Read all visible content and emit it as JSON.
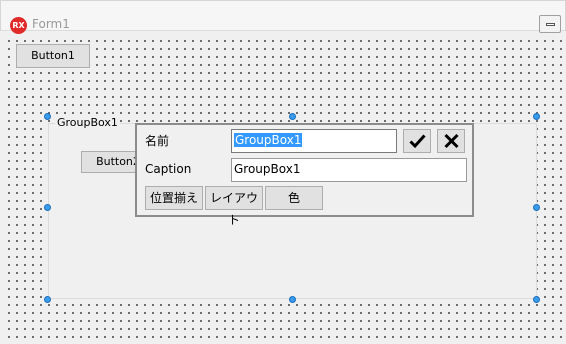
{
  "window": {
    "title": "Form1",
    "app_icon": "RX"
  },
  "form": {
    "button1_label": "Button1",
    "groupbox_label": "GroupBox1",
    "button2_label": "Button2"
  },
  "editor": {
    "name_label": "名前",
    "name_value": "GroupBox1",
    "caption_label": "Caption",
    "caption_value": "GroupBox1",
    "ok_icon": "check-icon",
    "cancel_icon": "x-icon",
    "align_label": "位置揃え",
    "layout_label": "レイアウト",
    "color_label": "色"
  },
  "colors": {
    "app_icon": "#e02a2a",
    "selection": "#3399ff",
    "handle": "#3b9be6"
  }
}
